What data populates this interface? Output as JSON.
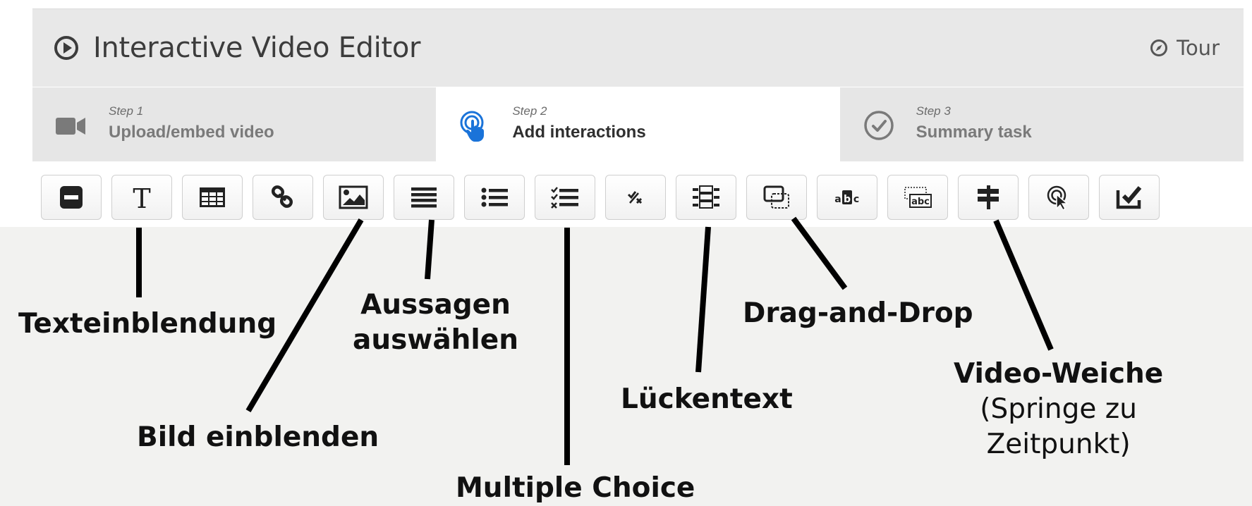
{
  "app": {
    "title": "Interactive Video Editor",
    "tour_label": "Tour",
    "play_icon": "play-circle-icon",
    "tour_icon": "compass-icon"
  },
  "steps": [
    {
      "kicker": "Step 1",
      "label": "Upload/embed video",
      "icon": "video-camera-icon",
      "active": false
    },
    {
      "kicker": "Step 2",
      "label": "Add interactions",
      "icon": "touch-pointer-icon",
      "active": true
    },
    {
      "kicker": "Step 3",
      "label": "Summary task",
      "icon": "check-circle-icon",
      "active": false
    }
  ],
  "toolbar": {
    "tools": [
      {
        "name": "label-tool",
        "icon": "minus-box-icon"
      },
      {
        "name": "text-tool",
        "icon": "text-t-icon"
      },
      {
        "name": "table-tool",
        "icon": "table-icon"
      },
      {
        "name": "link-tool",
        "icon": "link-icon"
      },
      {
        "name": "image-tool",
        "icon": "image-icon"
      },
      {
        "name": "statements-tool",
        "icon": "list-icon"
      },
      {
        "name": "single-choice-set-tool",
        "icon": "bullet-list-icon"
      },
      {
        "name": "multiple-choice-tool",
        "icon": "checklist-icon"
      },
      {
        "name": "true-false-tool",
        "icon": "check-x-icon"
      },
      {
        "name": "fill-in-blanks-tool",
        "icon": "blanks-icon"
      },
      {
        "name": "drag-and-drop-tool",
        "icon": "drag-drop-icon"
      },
      {
        "name": "mark-words-tool",
        "icon": "mark-words-icon"
      },
      {
        "name": "drag-text-tool",
        "icon": "drag-text-icon"
      },
      {
        "name": "crossroads-tool",
        "icon": "signpost-icon"
      },
      {
        "name": "navigation-hotspot-tool",
        "icon": "hotspot-icon"
      },
      {
        "name": "questionnaire-tool",
        "icon": "checkbox-corner-icon"
      }
    ],
    "mark_words_text": "abc",
    "drag_text_text": "abc"
  },
  "annotations": {
    "text": "Texteinblendung",
    "image": "Bild einblenden",
    "statements_line1": "Aussagen",
    "statements_line2": "auswählen",
    "multiple_choice": "Multiple Choice",
    "fill_blanks": "Lückentext",
    "drag_drop": "Drag-and-Drop",
    "crossroads_title": "Video-Weiche",
    "crossroads_sub1": "(Springe zu",
    "crossroads_sub2": "Zeitpunkt)"
  },
  "colors": {
    "accent": "#1a73d9",
    "header_bg": "#e8e8e8",
    "annotation_bg": "#f2f2f0",
    "icon_dark": "#222222"
  }
}
